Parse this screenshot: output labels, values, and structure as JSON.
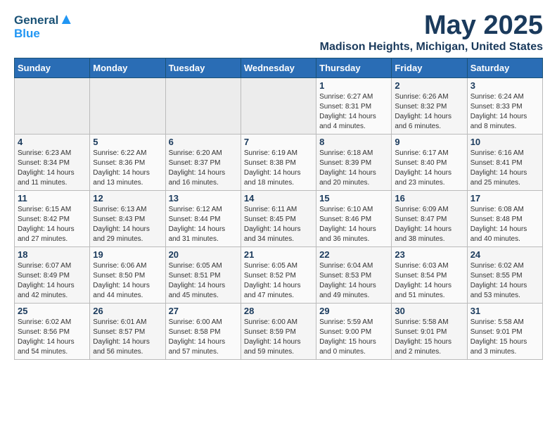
{
  "header": {
    "logo_line1": "General",
    "logo_line2": "Blue",
    "month_title": "May 2025",
    "location": "Madison Heights, Michigan, United States"
  },
  "days_of_week": [
    "Sunday",
    "Monday",
    "Tuesday",
    "Wednesday",
    "Thursday",
    "Friday",
    "Saturday"
  ],
  "weeks": [
    [
      {
        "day": "",
        "empty": true
      },
      {
        "day": "",
        "empty": true
      },
      {
        "day": "",
        "empty": true
      },
      {
        "day": "",
        "empty": true
      },
      {
        "day": "1",
        "sunrise": "6:27 AM",
        "sunset": "8:31 PM",
        "daylight": "14 hours and 4 minutes."
      },
      {
        "day": "2",
        "sunrise": "6:26 AM",
        "sunset": "8:32 PM",
        "daylight": "14 hours and 6 minutes."
      },
      {
        "day": "3",
        "sunrise": "6:24 AM",
        "sunset": "8:33 PM",
        "daylight": "14 hours and 8 minutes."
      }
    ],
    [
      {
        "day": "4",
        "sunrise": "6:23 AM",
        "sunset": "8:34 PM",
        "daylight": "14 hours and 11 minutes."
      },
      {
        "day": "5",
        "sunrise": "6:22 AM",
        "sunset": "8:36 PM",
        "daylight": "14 hours and 13 minutes."
      },
      {
        "day": "6",
        "sunrise": "6:20 AM",
        "sunset": "8:37 PM",
        "daylight": "14 hours and 16 minutes."
      },
      {
        "day": "7",
        "sunrise": "6:19 AM",
        "sunset": "8:38 PM",
        "daylight": "14 hours and 18 minutes."
      },
      {
        "day": "8",
        "sunrise": "6:18 AM",
        "sunset": "8:39 PM",
        "daylight": "14 hours and 20 minutes."
      },
      {
        "day": "9",
        "sunrise": "6:17 AM",
        "sunset": "8:40 PM",
        "daylight": "14 hours and 23 minutes."
      },
      {
        "day": "10",
        "sunrise": "6:16 AM",
        "sunset": "8:41 PM",
        "daylight": "14 hours and 25 minutes."
      }
    ],
    [
      {
        "day": "11",
        "sunrise": "6:15 AM",
        "sunset": "8:42 PM",
        "daylight": "14 hours and 27 minutes."
      },
      {
        "day": "12",
        "sunrise": "6:13 AM",
        "sunset": "8:43 PM",
        "daylight": "14 hours and 29 minutes."
      },
      {
        "day": "13",
        "sunrise": "6:12 AM",
        "sunset": "8:44 PM",
        "daylight": "14 hours and 31 minutes."
      },
      {
        "day": "14",
        "sunrise": "6:11 AM",
        "sunset": "8:45 PM",
        "daylight": "14 hours and 34 minutes."
      },
      {
        "day": "15",
        "sunrise": "6:10 AM",
        "sunset": "8:46 PM",
        "daylight": "14 hours and 36 minutes."
      },
      {
        "day": "16",
        "sunrise": "6:09 AM",
        "sunset": "8:47 PM",
        "daylight": "14 hours and 38 minutes."
      },
      {
        "day": "17",
        "sunrise": "6:08 AM",
        "sunset": "8:48 PM",
        "daylight": "14 hours and 40 minutes."
      }
    ],
    [
      {
        "day": "18",
        "sunrise": "6:07 AM",
        "sunset": "8:49 PM",
        "daylight": "14 hours and 42 minutes."
      },
      {
        "day": "19",
        "sunrise": "6:06 AM",
        "sunset": "8:50 PM",
        "daylight": "14 hours and 44 minutes."
      },
      {
        "day": "20",
        "sunrise": "6:05 AM",
        "sunset": "8:51 PM",
        "daylight": "14 hours and 45 minutes."
      },
      {
        "day": "21",
        "sunrise": "6:05 AM",
        "sunset": "8:52 PM",
        "daylight": "14 hours and 47 minutes."
      },
      {
        "day": "22",
        "sunrise": "6:04 AM",
        "sunset": "8:53 PM",
        "daylight": "14 hours and 49 minutes."
      },
      {
        "day": "23",
        "sunrise": "6:03 AM",
        "sunset": "8:54 PM",
        "daylight": "14 hours and 51 minutes."
      },
      {
        "day": "24",
        "sunrise": "6:02 AM",
        "sunset": "8:55 PM",
        "daylight": "14 hours and 53 minutes."
      }
    ],
    [
      {
        "day": "25",
        "sunrise": "6:02 AM",
        "sunset": "8:56 PM",
        "daylight": "14 hours and 54 minutes."
      },
      {
        "day": "26",
        "sunrise": "6:01 AM",
        "sunset": "8:57 PM",
        "daylight": "14 hours and 56 minutes."
      },
      {
        "day": "27",
        "sunrise": "6:00 AM",
        "sunset": "8:58 PM",
        "daylight": "14 hours and 57 minutes."
      },
      {
        "day": "28",
        "sunrise": "6:00 AM",
        "sunset": "8:59 PM",
        "daylight": "14 hours and 59 minutes."
      },
      {
        "day": "29",
        "sunrise": "5:59 AM",
        "sunset": "9:00 PM",
        "daylight": "15 hours and 0 minutes."
      },
      {
        "day": "30",
        "sunrise": "5:58 AM",
        "sunset": "9:01 PM",
        "daylight": "15 hours and 2 minutes."
      },
      {
        "day": "31",
        "sunrise": "5:58 AM",
        "sunset": "9:01 PM",
        "daylight": "15 hours and 3 minutes."
      }
    ]
  ],
  "labels": {
    "sunrise": "Sunrise:",
    "sunset": "Sunset:",
    "daylight": "Daylight:"
  }
}
